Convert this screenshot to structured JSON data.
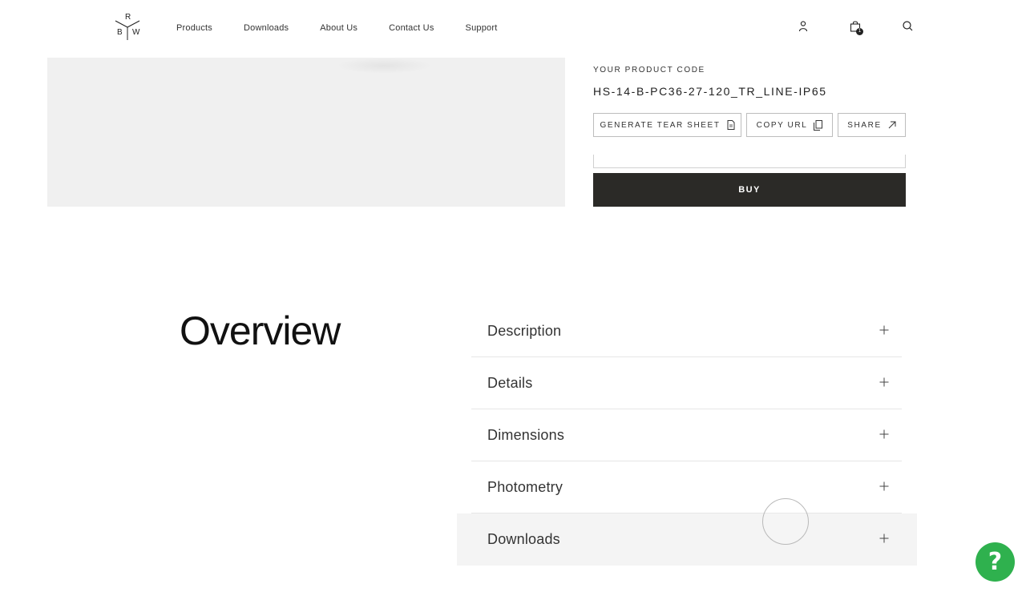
{
  "header": {
    "logo_letters": {
      "top": "R",
      "left": "B",
      "right": "W"
    },
    "nav": [
      "Products",
      "Downloads",
      "About Us",
      "Contact Us",
      "Support"
    ],
    "icons": [
      "account-icon",
      "cart-icon",
      "search-icon"
    ],
    "cart_count": "1"
  },
  "product": {
    "code_label": "YOUR PRODUCT CODE",
    "code_value": "HS-14-B-PC36-27-120_TR_LINE-IP65",
    "actions": {
      "tear_sheet": "GENERATE TEAR SHEET",
      "copy_url": "COPY URL",
      "share": "SHARE"
    },
    "buy_label": "BUY"
  },
  "overview": {
    "title": "Overview",
    "sections": [
      "Description",
      "Details",
      "Dimensions",
      "Photometry",
      "Downloads"
    ]
  },
  "help": {
    "label": "?",
    "color": "#2fb14e"
  },
  "colors": {
    "buy_button": "#2b2a27",
    "gallery_bg": "#f0f0f0"
  }
}
